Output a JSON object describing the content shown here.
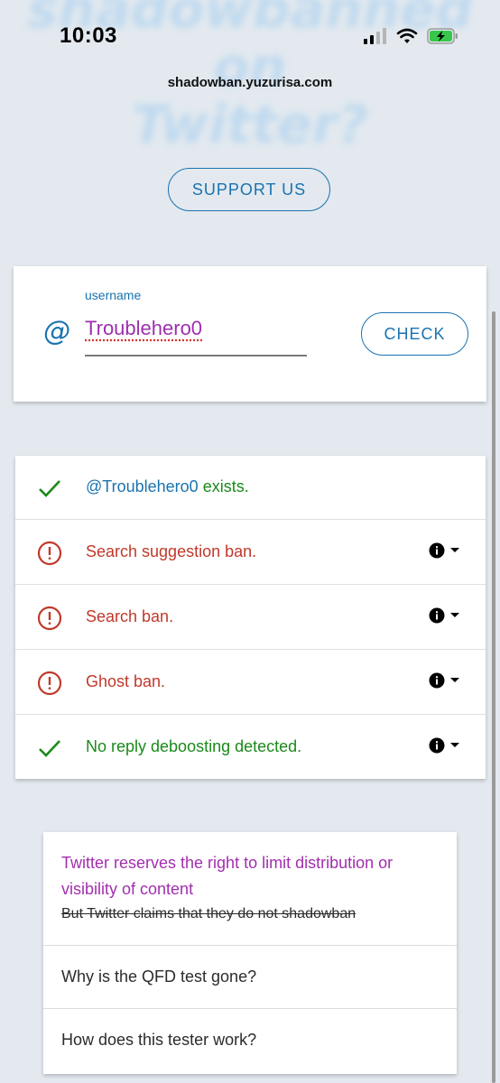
{
  "status_bar": {
    "time": "10:03"
  },
  "background_banner": {
    "line1": "shadowbanned on",
    "line2": "Twitter?"
  },
  "url": "shadowban.yuzurisa.com",
  "support_button": {
    "label": "SUPPORT US"
  },
  "search": {
    "prefix": "@",
    "label": "username",
    "value": "Troublehero0",
    "check_label": "CHECK"
  },
  "results": [
    {
      "status": "ok",
      "icon": "check-icon",
      "handle": "@Troublehero0",
      "text": " exists.",
      "has_info": false
    },
    {
      "status": "bad",
      "icon": "alert-circle-icon",
      "text": "Search suggestion ban.",
      "has_info": true
    },
    {
      "status": "bad",
      "icon": "alert-circle-icon",
      "text": "Search ban.",
      "has_info": true
    },
    {
      "status": "bad",
      "icon": "alert-circle-icon",
      "text": "Ghost ban.",
      "has_info": true
    },
    {
      "status": "ok",
      "icon": "check-icon",
      "text": "No reply deboosting detected.",
      "has_info": true
    }
  ],
  "faq": [
    {
      "title": "Twitter reserves the right to limit distribution or visibility of content",
      "subtitle": "But Twitter claims that they do not shadowban"
    },
    {
      "title": "Why is the QFD test gone?"
    },
    {
      "title": "How does this tester work?"
    }
  ],
  "colors": {
    "accent": "#1a73b0",
    "ok": "#1a8a1a",
    "bad": "#c0392b",
    "purple": "#a22fae",
    "background": "#e3e9ef"
  }
}
